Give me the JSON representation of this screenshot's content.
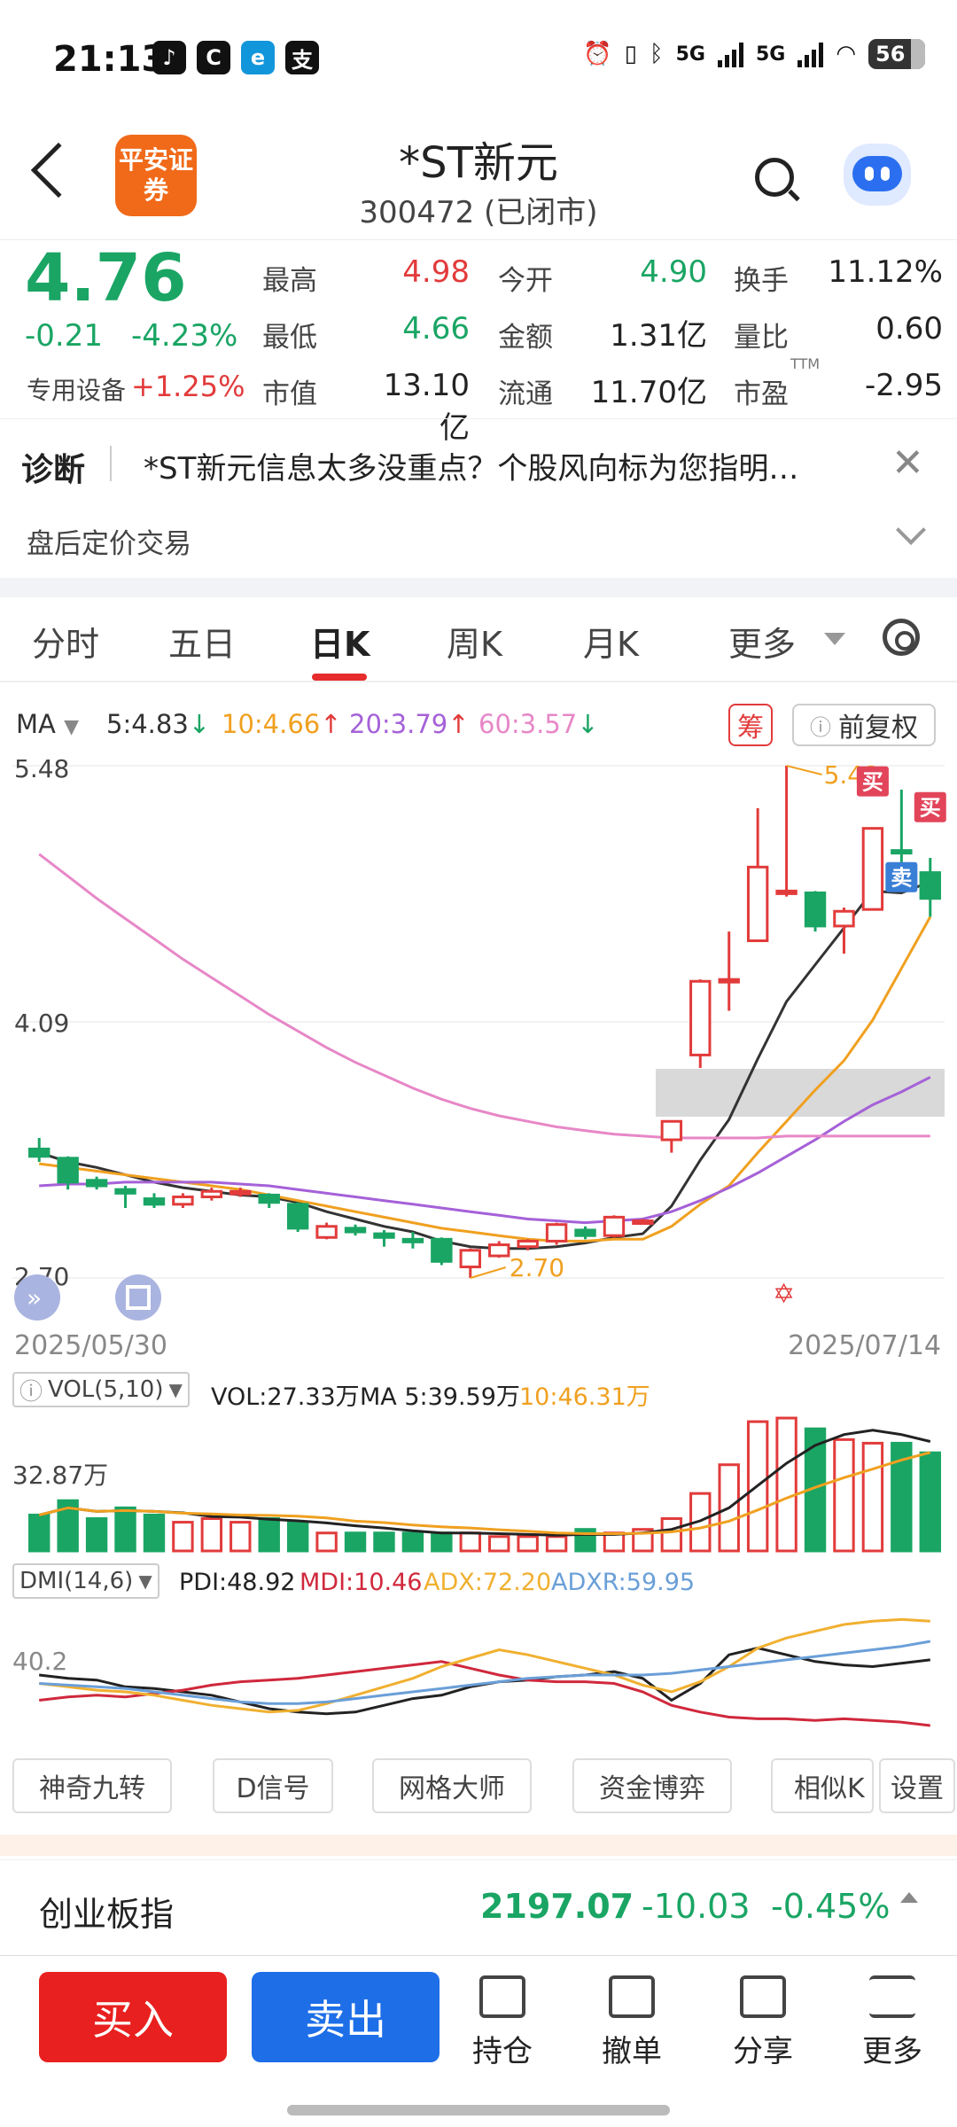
{
  "status": {
    "time": "21:13",
    "app_icons": [
      "tiktok-icon",
      "c-app-icon",
      "e-app-icon",
      "alipay-icon"
    ],
    "network": "5G",
    "battery": "56"
  },
  "header": {
    "logo_text": "平安证券",
    "title": "*ST新元",
    "subtitle": "300472 (已闭市)"
  },
  "quote": {
    "price": "4.76",
    "change": "-0.21",
    "change_pct": "-4.23%",
    "industry": "专用设备",
    "industry_pct": "+1.25%",
    "fields": [
      {
        "label": "最高",
        "value": "4.98",
        "color": "red"
      },
      {
        "label": "今开",
        "value": "4.90",
        "color": "green"
      },
      {
        "label": "换手",
        "value": "11.12%",
        "color": "dark"
      },
      {
        "label": "最低",
        "value": "4.66",
        "color": "green"
      },
      {
        "label": "金额",
        "value": "1.31亿",
        "color": "dark"
      },
      {
        "label": "量比",
        "value": "0.60",
        "color": "dark"
      },
      {
        "label": "市值",
        "value": "13.10亿",
        "color": "dark"
      },
      {
        "label": "流通",
        "value": "11.70亿",
        "color": "dark"
      },
      {
        "label": "市盈",
        "value": "-2.95",
        "color": "dark",
        "sup": "TTM"
      }
    ]
  },
  "diagnose": {
    "label": "诊断",
    "text": "*ST新元信息太多没重点？个股风向标为您指明…"
  },
  "after_hours": "盘后定价交易",
  "tabs": [
    "分时",
    "五日",
    "日K",
    "周K",
    "月K",
    "更多"
  ],
  "active_tab": "日K",
  "ma_legend": {
    "label": "MA",
    "ma5": "5:4.83",
    "ma10": "10:4.66",
    "ma20": "20:3.79",
    "ma60": "60:3.57"
  },
  "chips_button": "筹",
  "adjust_button": "前复权",
  "chart_data": {
    "type": "candlestick",
    "y_labels": [
      "5.48",
      "4.09",
      "2.70"
    ],
    "ylim": [
      2.7,
      5.48
    ],
    "x_labels": [
      "2025/05/30",
      "2025/07/14"
    ],
    "high_annotation": "5.48",
    "low_annotation": "2.70",
    "buy_marker": "买",
    "sell_marker": "卖",
    "candles": [
      {
        "o": 3.4,
        "c": 3.36,
        "h": 3.46,
        "l": 3.33
      },
      {
        "o": 3.35,
        "c": 3.22,
        "h": 3.36,
        "l": 3.18
      },
      {
        "o": 3.23,
        "c": 3.2,
        "h": 3.25,
        "l": 3.18
      },
      {
        "o": 3.18,
        "c": 3.16,
        "h": 3.2,
        "l": 3.08
      },
      {
        "o": 3.13,
        "c": 3.1,
        "h": 3.16,
        "l": 3.08
      },
      {
        "o": 3.1,
        "c": 3.14,
        "h": 3.16,
        "l": 3.08
      },
      {
        "o": 3.14,
        "c": 3.17,
        "h": 3.19,
        "l": 3.12
      },
      {
        "o": 3.16,
        "c": 3.17,
        "h": 3.19,
        "l": 3.14
      },
      {
        "o": 3.15,
        "c": 3.11,
        "h": 3.16,
        "l": 3.08
      },
      {
        "o": 3.1,
        "c": 2.97,
        "h": 3.11,
        "l": 2.95
      },
      {
        "o": 2.92,
        "c": 2.98,
        "h": 3.0,
        "l": 2.91
      },
      {
        "o": 2.97,
        "c": 2.95,
        "h": 2.99,
        "l": 2.93
      },
      {
        "o": 2.94,
        "c": 2.92,
        "h": 2.96,
        "l": 2.87
      },
      {
        "o": 2.91,
        "c": 2.9,
        "h": 2.95,
        "l": 2.86
      },
      {
        "o": 2.91,
        "c": 2.79,
        "h": 2.92,
        "l": 2.77
      },
      {
        "o": 2.76,
        "c": 2.85,
        "h": 2.86,
        "l": 2.7
      },
      {
        "o": 2.82,
        "c": 2.88,
        "h": 2.9,
        "l": 2.81
      },
      {
        "o": 2.87,
        "c": 2.9,
        "h": 2.91,
        "l": 2.85
      },
      {
        "o": 2.9,
        "c": 2.99,
        "h": 3.0,
        "l": 2.88
      },
      {
        "o": 2.96,
        "c": 2.93,
        "h": 2.98,
        "l": 2.91
      },
      {
        "o": 2.93,
        "c": 3.03,
        "h": 3.04,
        "l": 2.92
      },
      {
        "o": 3.0,
        "c": 3.01,
        "h": 3.02,
        "l": 2.99
      },
      {
        "o": 3.45,
        "c": 3.55,
        "h": 3.55,
        "l": 3.38
      },
      {
        "o": 3.91,
        "c": 4.31,
        "h": 4.32,
        "l": 3.84
      },
      {
        "o": 4.32,
        "c": 4.32,
        "h": 4.58,
        "l": 4.15
      },
      {
        "o": 4.53,
        "c": 4.93,
        "h": 5.25,
        "l": 4.53
      },
      {
        "o": 4.8,
        "c": 4.8,
        "h": 5.48,
        "l": 4.77
      },
      {
        "o": 4.79,
        "c": 4.61,
        "h": 4.8,
        "l": 4.58
      },
      {
        "o": 4.61,
        "c": 4.69,
        "h": 4.71,
        "l": 4.46
      },
      {
        "o": 4.7,
        "c": 5.14,
        "h": 5.14,
        "l": 4.7
      },
      {
        "o": 5.02,
        "c": 5.01,
        "h": 5.35,
        "l": 4.92
      },
      {
        "o": 4.9,
        "c": 4.76,
        "h": 4.98,
        "l": 4.66
      }
    ],
    "ma_lines": [
      {
        "name": "MA5",
        "color": "#333333",
        "values": [
          3.38,
          3.33,
          3.3,
          3.26,
          3.22,
          3.19,
          3.17,
          3.15,
          3.14,
          3.11,
          3.06,
          3.02,
          2.98,
          2.95,
          2.9,
          2.87,
          2.86,
          2.86,
          2.87,
          2.89,
          2.92,
          2.94,
          3.09,
          3.34,
          3.56,
          3.89,
          4.2,
          4.4,
          4.6,
          4.8,
          4.79,
          4.85
        ]
      },
      {
        "name": "MA10",
        "color": "#f0a020",
        "values": [
          3.32,
          3.3,
          3.28,
          3.26,
          3.24,
          3.22,
          3.2,
          3.18,
          3.15,
          3.12,
          3.09,
          3.06,
          3.03,
          3.0,
          2.97,
          2.95,
          2.93,
          2.91,
          2.9,
          2.9,
          2.91,
          2.91,
          2.98,
          3.1,
          3.2,
          3.38,
          3.55,
          3.72,
          3.88,
          4.1,
          4.38,
          4.66
        ]
      },
      {
        "name": "MA20",
        "color": "#a561d8",
        "values": [
          3.2,
          3.21,
          3.21,
          3.22,
          3.22,
          3.22,
          3.22,
          3.21,
          3.2,
          3.18,
          3.16,
          3.14,
          3.12,
          3.1,
          3.08,
          3.06,
          3.04,
          3.02,
          3.01,
          3.0,
          3.01,
          3.02,
          3.06,
          3.12,
          3.19,
          3.27,
          3.36,
          3.45,
          3.55,
          3.64,
          3.71,
          3.79
        ]
      },
      {
        "name": "MA60",
        "color": "#e787c7",
        "values": [
          5.0,
          4.88,
          4.76,
          4.65,
          4.54,
          4.43,
          4.33,
          4.23,
          4.13,
          4.04,
          3.95,
          3.87,
          3.8,
          3.73,
          3.67,
          3.62,
          3.58,
          3.55,
          3.52,
          3.5,
          3.48,
          3.47,
          3.46,
          3.46,
          3.46,
          3.46,
          3.47,
          3.47,
          3.47,
          3.47,
          3.47,
          3.47
        ]
      }
    ],
    "volume": {
      "legend": {
        "title": "VOL(5,10)",
        "vol": "VOL:27.33万",
        "ma5": "MA 5:39.59万",
        "ma10": "10:46.31万"
      },
      "max_label": "32.87万",
      "values": [
        10,
        14,
        9,
        12,
        10,
        8,
        9,
        8,
        9,
        8,
        5,
        5,
        5,
        5,
        5,
        5,
        4,
        4,
        4,
        6,
        5,
        6,
        9,
        16,
        24,
        36,
        37,
        34,
        31,
        30,
        30,
        27.33
      ]
    },
    "dmi": {
      "legend": {
        "title": "DMI(14,6)",
        "pdi": "PDI:48.92",
        "mdi": "MDI:10.46",
        "adx": "ADX:72.20",
        "adxr": "ADXR:59.95"
      },
      "level_label": "40.2",
      "pdi": [
        40,
        38,
        37,
        33,
        32,
        30,
        28,
        24,
        20,
        18,
        17,
        18,
        22,
        26,
        28,
        33,
        36,
        37,
        39,
        40,
        42,
        38,
        25,
        35,
        52,
        56,
        52,
        48,
        46,
        45,
        47,
        49
      ],
      "mdi": [
        25,
        27,
        28,
        27,
        29,
        31,
        34,
        36,
        37,
        38,
        40,
        42,
        44,
        46,
        48,
        44,
        40,
        37,
        36,
        36,
        35,
        30,
        22,
        18,
        15,
        14,
        14,
        13,
        14,
        13,
        12,
        10
      ],
      "adx": [
        35,
        33,
        31,
        30,
        28,
        25,
        22,
        20,
        18,
        19,
        23,
        28,
        33,
        38,
        45,
        50,
        55,
        52,
        48,
        44,
        40,
        34,
        30,
        36,
        45,
        56,
        62,
        66,
        70,
        72,
        73,
        72
      ],
      "adxr": [
        35,
        34,
        33,
        32,
        30,
        28,
        26,
        24,
        23,
        23,
        24,
        26,
        28,
        30,
        32,
        34,
        36,
        38,
        39,
        40,
        40,
        40,
        41,
        43,
        45,
        47,
        49,
        51,
        53,
        55,
        57,
        60
      ]
    }
  },
  "tool_buttons": [
    "神奇九转",
    "D信号",
    "网格大师",
    "资金博弈",
    "相似K",
    "设置"
  ],
  "index_bar": {
    "name": "创业板指",
    "value": "2197.07",
    "change": "-10.03",
    "pct": "-0.45%"
  },
  "bottom_nav": {
    "buy": "买入",
    "sell": "卖出",
    "items": [
      "持仓",
      "撤单",
      "分享",
      "更多"
    ]
  }
}
